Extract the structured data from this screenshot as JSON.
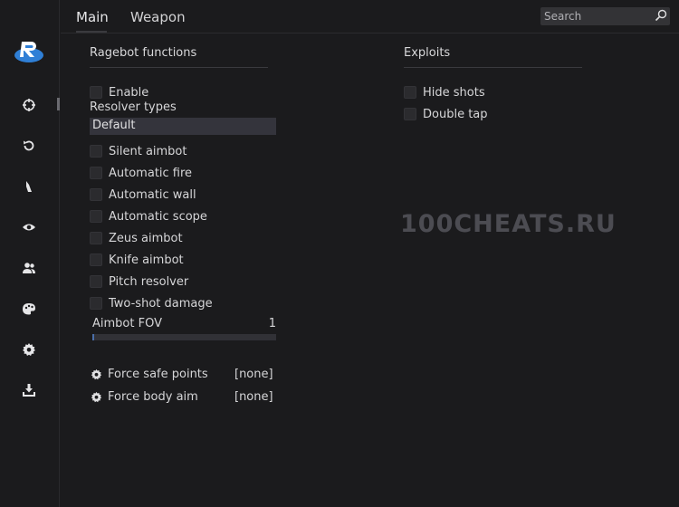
{
  "tabs": {
    "main": "Main",
    "weapon": "Weapon"
  },
  "search": {
    "placeholder": "Search"
  },
  "sidebar": {
    "icons": [
      "crosshair-icon",
      "refresh-icon",
      "mouse-icon",
      "eye-icon",
      "users-icon",
      "palette-icon",
      "gear-icon",
      "download-icon"
    ]
  },
  "ragebot": {
    "title": "Ragebot functions",
    "enable": "Enable",
    "resolver_label": "Resolver types",
    "resolver_value": "Default",
    "options": [
      "Silent aimbot",
      "Automatic fire",
      "Automatic wall",
      "Automatic scope",
      "Zeus aimbot",
      "Knife aimbot",
      "Pitch resolver",
      "Two-shot damage"
    ],
    "fov_label": "Aimbot FOV",
    "fov_value": "1",
    "fov_fraction": 0.01,
    "force_safe_points": "Force safe points",
    "force_safe_points_value": "[none]",
    "force_body_aim": "Force body aim",
    "force_body_aim_value": "[none]"
  },
  "exploits": {
    "title": "Exploits",
    "options": [
      "Hide shots",
      "Double tap"
    ]
  },
  "watermark": "100CHEATS.RU",
  "colors": {
    "accent": "#4a6ea9",
    "background": "#1b1b1d",
    "checkbox": "#2b2b2e",
    "dropdown": "#34343c"
  }
}
